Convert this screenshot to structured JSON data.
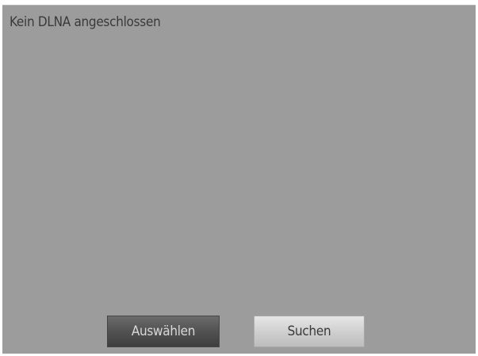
{
  "dialog": {
    "title": "Kein DLNA angeschlossen"
  },
  "buttons": {
    "select_label": "Auswählen",
    "search_label": "Suchen"
  },
  "colors": {
    "background": "#9c9c9c",
    "button_selected": "#545454",
    "button_normal": "#d0d0d0"
  }
}
